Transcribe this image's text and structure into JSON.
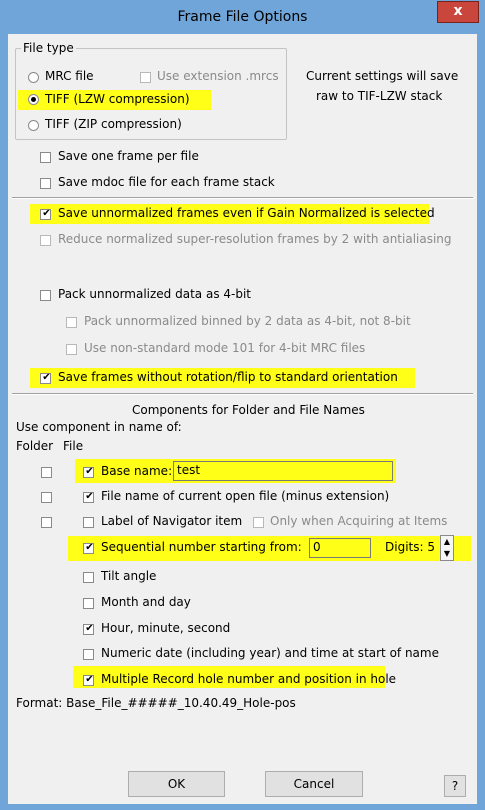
{
  "window": {
    "title": "Frame File Options",
    "close": "x"
  },
  "file_type": {
    "legend": "File type",
    "mrc": "MRC file",
    "use_ext": "Use extension .mrcs",
    "tiff_lzw": "TIFF (LZW compression)",
    "tiff_zip": "TIFF (ZIP compression)",
    "current_settings_1": "Current settings will save",
    "current_settings_2": "raw to TIF-LZW stack"
  },
  "options": {
    "one_frame": "Save one frame per file",
    "mdoc": "Save mdoc file for each frame stack",
    "unnormalized": "Save unnormalized frames even if Gain Normalized is selected",
    "reduce": "Reduce normalized super-resolution frames by 2 with antialiasing",
    "pack4": "Pack unnormalized data as 4-bit",
    "pack_binned": "Pack unnormalized binned by 2 data as 4-bit, not 8-bit",
    "mode101": "Use non-standard mode 101 for 4-bit MRC files",
    "no_rotation": "Save frames without rotation/flip to standard orientation"
  },
  "components": {
    "heading": "Components for Folder and File Names",
    "use_in_name": "Use component in name of:",
    "col_folder": "Folder",
    "col_file": "File",
    "base_name": "Base name:",
    "base_name_value": "test",
    "current_file": "File name of current open file (minus extension)",
    "nav_label": "Label of Navigator item",
    "only_acquiring": "Only when Acquiring at Items",
    "sequential": "Sequential number starting from:",
    "sequential_value": "0",
    "digits_label": "Digits: 5",
    "tilt": "Tilt angle",
    "month_day": "Month and day",
    "hms": "Hour, minute, second",
    "numeric_date": "Numeric date (including year) and time at start of name",
    "multi_record": "Multiple Record hole number and position in hole"
  },
  "format": "Format: Base_File_#####_10.40.49_Hole-pos",
  "buttons": {
    "ok": "OK",
    "cancel": "Cancel",
    "help": "?"
  },
  "colors": {
    "highlight": "#ffff17",
    "titlebar": "#6fa5d8",
    "close": "#c9463d"
  }
}
